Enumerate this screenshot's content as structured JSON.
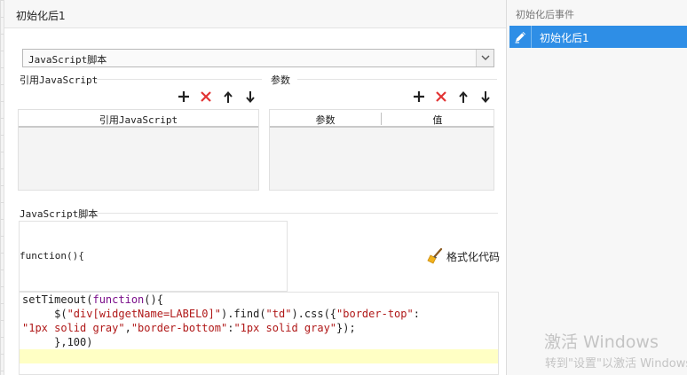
{
  "dialog": {
    "title": "初始化后1"
  },
  "script_type": {
    "value": "JavaScript脚本"
  },
  "ref_js": {
    "section_label": "引用JavaScript",
    "columns": [
      "引用JavaScript"
    ],
    "rows": []
  },
  "params": {
    "section_label": "参数",
    "columns": [
      "参数",
      "值"
    ],
    "rows": []
  },
  "script": {
    "section_label": "JavaScript脚本",
    "function_header": "function(){",
    "format_label": "格式化代码",
    "code_lines": [
      [
        {
          "t": "setTimeout(",
          "c": "pl"
        },
        {
          "t": "function",
          "c": "kw"
        },
        {
          "t": "(){",
          "c": "pl"
        }
      ],
      [
        {
          "t": "     $(",
          "c": "pl"
        },
        {
          "t": "\"div[widgetName=LABEL0]\"",
          "c": "str"
        },
        {
          "t": ").find(",
          "c": "pl"
        },
        {
          "t": "\"td\"",
          "c": "str"
        },
        {
          "t": ").css({",
          "c": "pl"
        },
        {
          "t": "\"border-top\"",
          "c": "str"
        },
        {
          "t": ":",
          "c": "pl"
        }
      ],
      [
        {
          "t": "\"1px solid gray\"",
          "c": "str"
        },
        {
          "t": ",",
          "c": "pl"
        },
        {
          "t": "\"border-bottom\"",
          "c": "str"
        },
        {
          "t": ":",
          "c": "pl"
        },
        {
          "t": "\"1px solid gray\"",
          "c": "str"
        },
        {
          "t": "});",
          "c": "pl"
        }
      ],
      [
        {
          "t": "     },100)",
          "c": "pl"
        }
      ]
    ]
  },
  "events_panel": {
    "title": "初始化后事件",
    "items": [
      {
        "label": "初始化后1",
        "icon": "pencil-icon",
        "selected": true
      }
    ]
  },
  "watermark": {
    "line1": "激活 Windows",
    "line2": "转到\"设置\"以激活 Windows。"
  },
  "colors": {
    "accent": "#2e8ee6",
    "delete": "#e23434",
    "keyword": "#7a0e8a",
    "string": "#b01818",
    "current_line": "#ffffc4"
  }
}
